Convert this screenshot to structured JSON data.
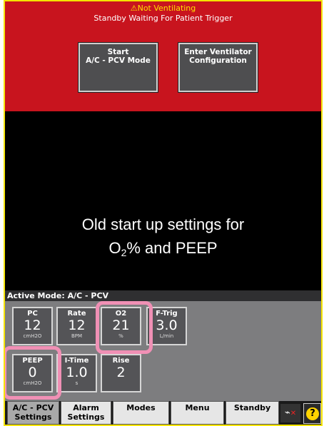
{
  "alarm": {
    "title": "Not Ventilating",
    "subtitle": "Standby Waiting For Patient Trigger",
    "warning_icon": "warning-triangle-icon"
  },
  "actions": {
    "start_line1": "Start",
    "start_line2": "A/C - PCV Mode",
    "config_line1": "Enter Ventilator",
    "config_line2": "Configuration"
  },
  "annotation": {
    "line1": "Old start up settings for",
    "line2_pre": "O",
    "line2_sub": "2",
    "line2_post": "% and PEEP"
  },
  "mode": {
    "label": "Active Mode: A/C - PCV"
  },
  "settings": [
    {
      "label": "PC",
      "value": "12",
      "unit": "cmH2O"
    },
    {
      "label": "Rate",
      "value": "12",
      "unit": "BPM"
    },
    {
      "label": "O2",
      "value": "21",
      "unit": "%"
    },
    {
      "label": "F-Trig",
      "value": "3.0",
      "unit": "L/min"
    },
    {
      "label": "PEEP",
      "value": "0",
      "unit": "cmH2O"
    },
    {
      "label": "I-Time",
      "value": "1.0",
      "unit": "s"
    },
    {
      "label": "Rise",
      "value": "2",
      "unit": ""
    }
  ],
  "nav": {
    "mode_line1": "A/C - PCV",
    "mode_line2": "Settings",
    "alarm_line1": "Alarm",
    "alarm_line2": "Settings",
    "modes": "Modes",
    "menu": "Menu",
    "standby": "Standby",
    "help": "?"
  },
  "colors": {
    "alarm_red": "#c8141e",
    "alarm_yellow": "#ffe000",
    "highlight_pink": "#f090b5",
    "screen_border": "#f5e400"
  }
}
